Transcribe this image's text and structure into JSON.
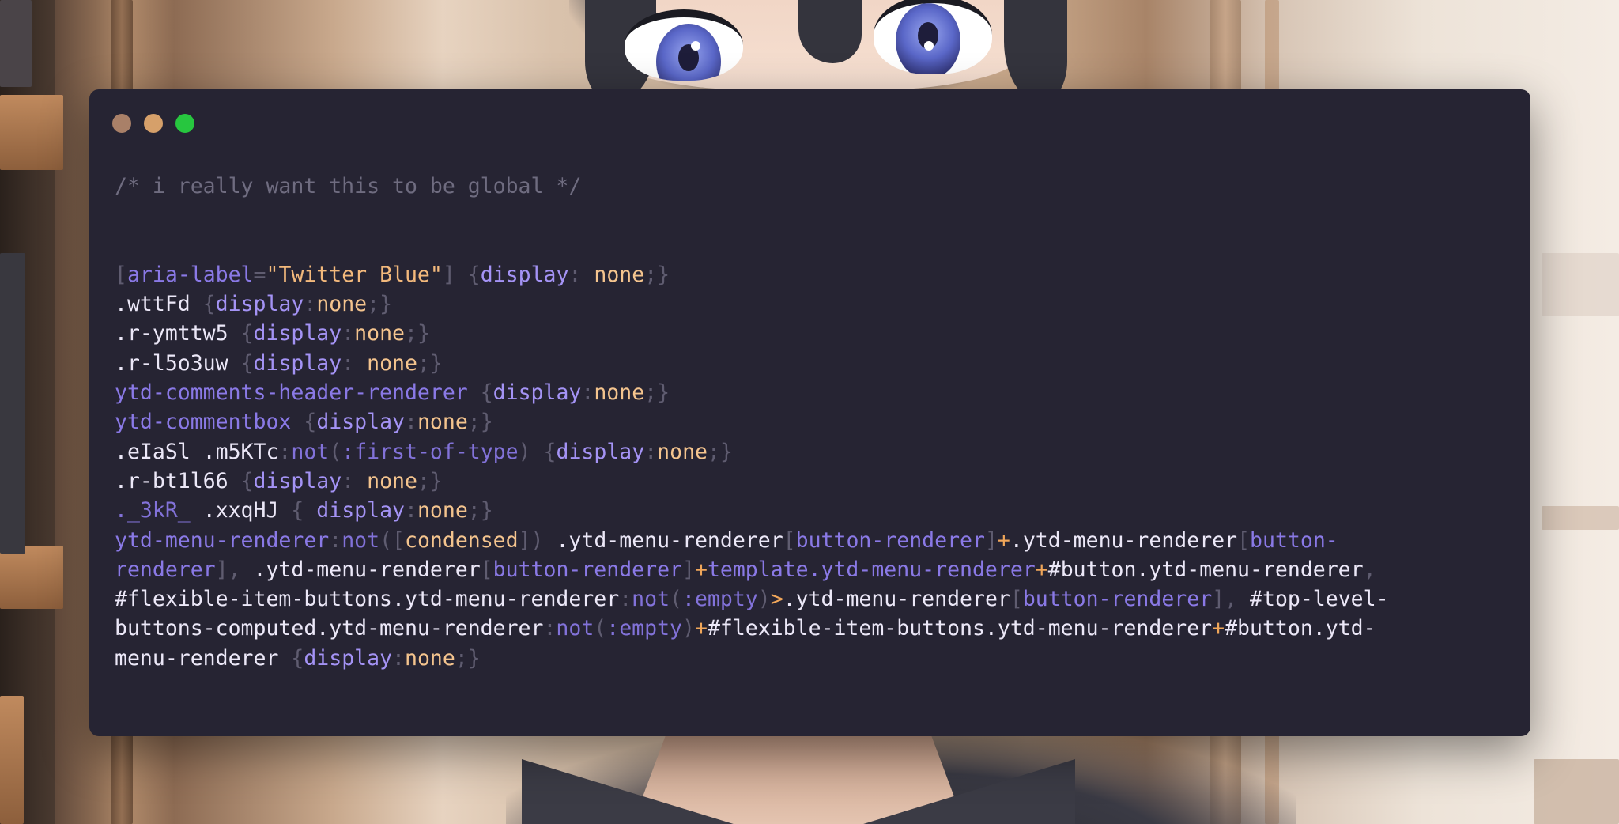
{
  "window": {
    "controls": [
      "close",
      "minimize",
      "maximize"
    ]
  },
  "code": {
    "lines": [
      [
        {
          "t": "/* i really want this to be global */",
          "k": "com"
        }
      ],
      [],
      [],
      [
        {
          "t": "[",
          "k": "pun"
        },
        {
          "t": "aria-label",
          "k": "tag"
        },
        {
          "t": "=",
          "k": "pun"
        },
        {
          "t": "\"Twitter Blue\"",
          "k": "str"
        },
        {
          "t": "]",
          "k": "pun"
        },
        {
          "t": " ",
          "k": "cls"
        },
        {
          "t": "{",
          "k": "pun"
        },
        {
          "t": "display",
          "k": "kw"
        },
        {
          "t": ": ",
          "k": "pun"
        },
        {
          "t": "none",
          "k": "val"
        },
        {
          "t": ";}",
          "k": "pun"
        }
      ],
      [
        {
          "t": ".wttFd ",
          "k": "cls"
        },
        {
          "t": "{",
          "k": "pun"
        },
        {
          "t": "display",
          "k": "kw"
        },
        {
          "t": ":",
          "k": "pun"
        },
        {
          "t": "none",
          "k": "val"
        },
        {
          "t": ";}",
          "k": "pun"
        }
      ],
      [
        {
          "t": ".r-ymttw5 ",
          "k": "cls"
        },
        {
          "t": "{",
          "k": "pun"
        },
        {
          "t": "display",
          "k": "kw"
        },
        {
          "t": ":",
          "k": "pun"
        },
        {
          "t": "none",
          "k": "val"
        },
        {
          "t": ";}",
          "k": "pun"
        }
      ],
      [
        {
          "t": ".r-l5o3uw ",
          "k": "cls"
        },
        {
          "t": "{",
          "k": "pun"
        },
        {
          "t": "display",
          "k": "kw"
        },
        {
          "t": ": ",
          "k": "pun"
        },
        {
          "t": "none",
          "k": "val"
        },
        {
          "t": ";}",
          "k": "pun"
        }
      ],
      [
        {
          "t": "ytd-comments-header-renderer",
          "k": "tag"
        },
        {
          "t": " ",
          "k": "cls"
        },
        {
          "t": "{",
          "k": "pun"
        },
        {
          "t": "display",
          "k": "kw"
        },
        {
          "t": ":",
          "k": "pun"
        },
        {
          "t": "none",
          "k": "val"
        },
        {
          "t": ";}",
          "k": "pun"
        }
      ],
      [
        {
          "t": "ytd-commentbox",
          "k": "tag"
        },
        {
          "t": " ",
          "k": "cls"
        },
        {
          "t": "{",
          "k": "pun"
        },
        {
          "t": "display",
          "k": "kw"
        },
        {
          "t": ":",
          "k": "pun"
        },
        {
          "t": "none",
          "k": "val"
        },
        {
          "t": ";}",
          "k": "pun"
        }
      ],
      [
        {
          "t": ".eIaSl .m5KTc",
          "k": "cls"
        },
        {
          "t": ":",
          "k": "pun"
        },
        {
          "t": "not",
          "k": "ps"
        },
        {
          "t": "(",
          "k": "pun"
        },
        {
          "t": ":first-of-type",
          "k": "ps"
        },
        {
          "t": ") ",
          "k": "pun"
        },
        {
          "t": "{",
          "k": "pun"
        },
        {
          "t": "display",
          "k": "kw"
        },
        {
          "t": ":",
          "k": "pun"
        },
        {
          "t": "none",
          "k": "val"
        },
        {
          "t": ";}",
          "k": "pun"
        }
      ],
      [
        {
          "t": ".r-bt1l66 ",
          "k": "cls"
        },
        {
          "t": "{",
          "k": "pun"
        },
        {
          "t": "display",
          "k": "kw"
        },
        {
          "t": ": ",
          "k": "pun"
        },
        {
          "t": "none",
          "k": "val"
        },
        {
          "t": ";}",
          "k": "pun"
        }
      ],
      [
        {
          "t": "._3kR_",
          "k": "ps"
        },
        {
          "t": " .xxqHJ ",
          "k": "cls"
        },
        {
          "t": "{ ",
          "k": "pun"
        },
        {
          "t": "display",
          "k": "kw"
        },
        {
          "t": ":",
          "k": "pun"
        },
        {
          "t": "none",
          "k": "val"
        },
        {
          "t": ";}",
          "k": "pun"
        }
      ],
      [
        {
          "t": "ytd-menu-renderer",
          "k": "tag"
        },
        {
          "t": ":",
          "k": "pun"
        },
        {
          "t": "not",
          "k": "ps"
        },
        {
          "t": "([",
          "k": "pun"
        },
        {
          "t": "condensed",
          "k": "val"
        },
        {
          "t": "]) ",
          "k": "pun"
        },
        {
          "t": ".ytd-menu-renderer",
          "k": "cls"
        },
        {
          "t": "[",
          "k": "pun"
        },
        {
          "t": "button-renderer",
          "k": "tag"
        },
        {
          "t": "]",
          "k": "pun"
        },
        {
          "t": "+",
          "k": "op"
        },
        {
          "t": ".ytd-menu-renderer",
          "k": "cls"
        },
        {
          "t": "[",
          "k": "pun"
        },
        {
          "t": "button-",
          "k": "tag"
        }
      ],
      [
        {
          "t": "renderer",
          "k": "tag"
        },
        {
          "t": "], ",
          "k": "pun"
        },
        {
          "t": ".ytd-menu-renderer",
          "k": "cls"
        },
        {
          "t": "[",
          "k": "pun"
        },
        {
          "t": "button-renderer",
          "k": "tag"
        },
        {
          "t": "]",
          "k": "pun"
        },
        {
          "t": "+",
          "k": "op"
        },
        {
          "t": "template.ytd-menu-renderer",
          "k": "tag"
        },
        {
          "t": "+",
          "k": "op"
        },
        {
          "t": "#button.ytd-menu-renderer",
          "k": "cls"
        },
        {
          "t": ",",
          "k": "pun"
        }
      ],
      [
        {
          "t": "#flexible-item-buttons.ytd-menu-renderer",
          "k": "cls"
        },
        {
          "t": ":",
          "k": "pun"
        },
        {
          "t": "not",
          "k": "ps"
        },
        {
          "t": "(",
          "k": "pun"
        },
        {
          "t": ":empty",
          "k": "ps"
        },
        {
          "t": ")",
          "k": "pun"
        },
        {
          "t": ">",
          "k": "op"
        },
        {
          "t": ".ytd-menu-renderer",
          "k": "cls"
        },
        {
          "t": "[",
          "k": "pun"
        },
        {
          "t": "button-renderer",
          "k": "tag"
        },
        {
          "t": "], ",
          "k": "pun"
        },
        {
          "t": "#top-level-",
          "k": "cls"
        }
      ],
      [
        {
          "t": "buttons-computed.ytd-menu-renderer",
          "k": "cls"
        },
        {
          "t": ":",
          "k": "pun"
        },
        {
          "t": "not",
          "k": "ps"
        },
        {
          "t": "(",
          "k": "pun"
        },
        {
          "t": ":empty",
          "k": "ps"
        },
        {
          "t": ")",
          "k": "pun"
        },
        {
          "t": "+",
          "k": "op"
        },
        {
          "t": "#flexible-item-buttons.ytd-menu-renderer",
          "k": "cls"
        },
        {
          "t": "+",
          "k": "op"
        },
        {
          "t": "#button.ytd-",
          "k": "cls"
        }
      ],
      [
        {
          "t": "menu-renderer ",
          "k": "cls"
        },
        {
          "t": "{",
          "k": "pun"
        },
        {
          "t": "display",
          "k": "kw"
        },
        {
          "t": ":",
          "k": "pun"
        },
        {
          "t": "none",
          "k": "val"
        },
        {
          "t": ";}",
          "k": "pun"
        }
      ]
    ]
  }
}
